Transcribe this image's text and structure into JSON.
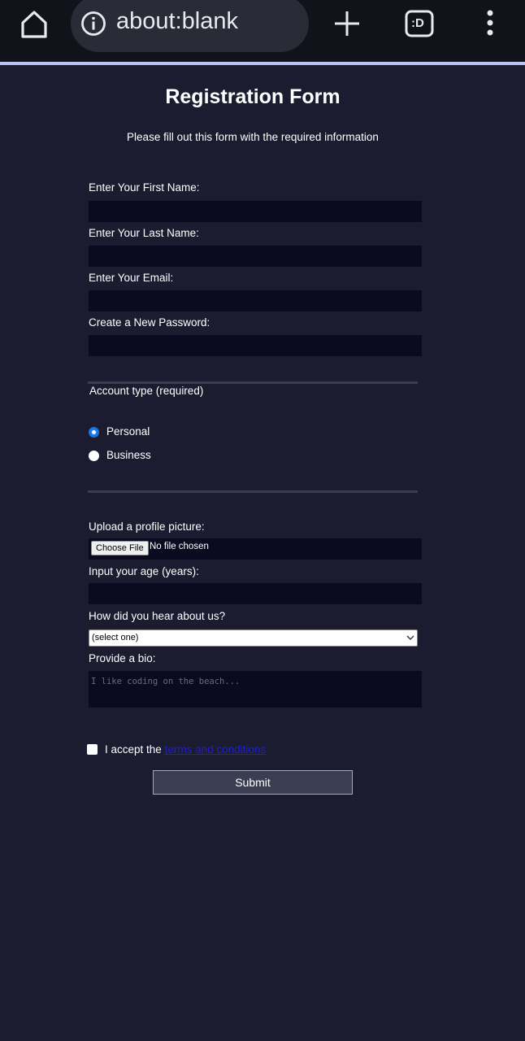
{
  "browser": {
    "url": "about:blank",
    "tabs_icon_text": ":D"
  },
  "form": {
    "title": "Registration Form",
    "subtitle": "Please fill out this form with the required information",
    "first_name_label": "Enter Your First Name:",
    "last_name_label": "Enter Your Last Name:",
    "email_label": "Enter Your Email:",
    "password_label": "Create a New Password:",
    "account_type_legend": "Account type (required)",
    "radio_options": [
      "Personal",
      "Business"
    ],
    "selected_radio": "Personal",
    "upload_label": "Upload a profile picture:",
    "file_button": "Choose File",
    "file_status": "No file chosen",
    "age_label": "Input your age (years):",
    "referral_label": "How did you hear about us?",
    "referral_selected": "(select one)",
    "bio_label": "Provide a bio:",
    "bio_placeholder": "I like coding on the beach...",
    "accept_text": "I accept the",
    "terms_link": "terms and conditions",
    "submit_label": "Submit"
  },
  "colors": {
    "background": "#1b1c30",
    "input_bg": "#0b0b20",
    "radio_accent": "#1a73e8",
    "link": "#1f1ed6"
  }
}
